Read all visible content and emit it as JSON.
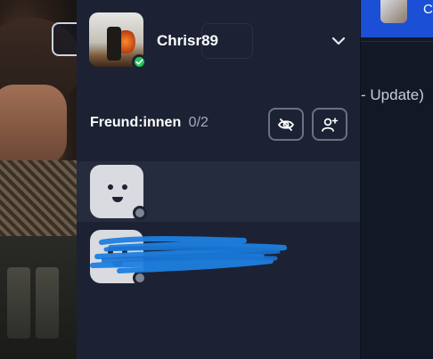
{
  "user": {
    "name": "Chrisr89",
    "status": "online"
  },
  "friends": {
    "label": "Freund:innen",
    "count": "0/2",
    "items": [
      {
        "name": "",
        "status": "offline"
      },
      {
        "name": "",
        "status": "offline"
      }
    ]
  },
  "right_panel": {
    "header_text": "C",
    "update_text": "- Update)"
  },
  "colors": {
    "panel_bg": "#1c2233",
    "selected_row": "#252c3e",
    "accent_blue": "#1a4fd6",
    "online_green": "#24c45a",
    "offline_gray": "#7f8593",
    "redaction_scribble": "#1e7fe0"
  },
  "icons": [
    "chevron-down-icon",
    "eye-slash-icon",
    "add-friend-icon",
    "check-icon",
    "chat-icon"
  ]
}
